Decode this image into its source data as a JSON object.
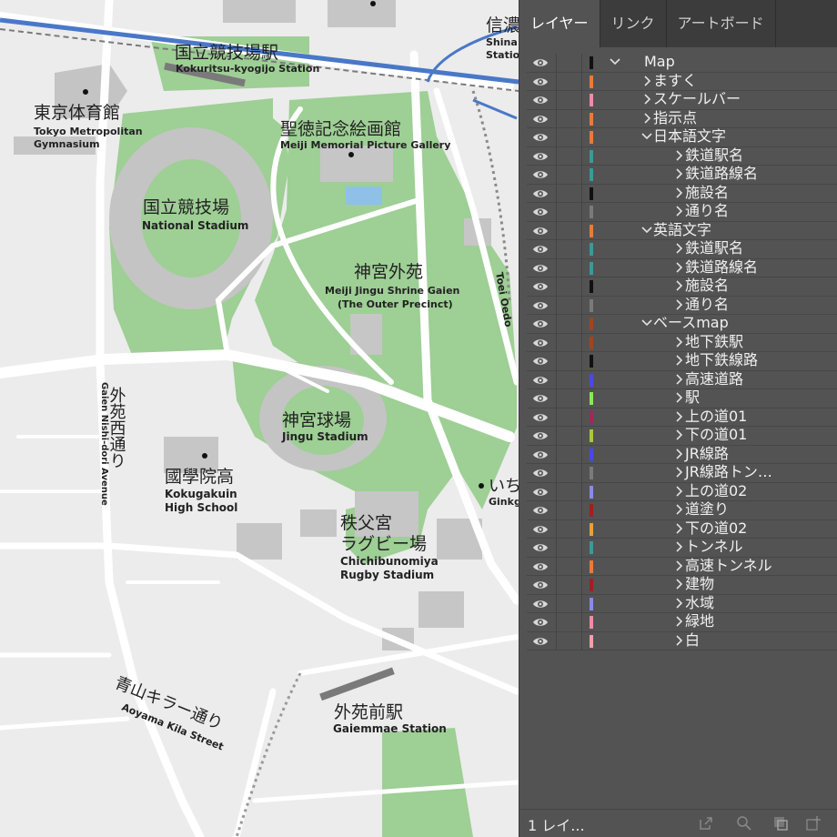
{
  "map": {
    "labels": {
      "kokuritsu_station_ja": "国立競技場駅",
      "kokuritsu_station_en": "Kokuritsu-kyogijo Station",
      "tokyo_gym_ja": "東京体育館",
      "tokyo_gym_en1": "Tokyo Metropolitan",
      "tokyo_gym_en2": "Gymnasium",
      "meiji_gallery_ja": "聖徳記念絵画館",
      "meiji_gallery_en": "Meiji Memorial Picture Gallery",
      "national_stadium_ja": "国立競技場",
      "national_stadium_en": "National Stadium",
      "gaien_ja": "神宮外苑",
      "gaien_en1": "Meiji Jingu Shrine Gaien",
      "gaien_en2": "(The Outer Precinct)",
      "jingu_stadium_ja": "神宮球場",
      "jingu_stadium_en": "Jingu Stadium",
      "gaien_nishi_ja": "外苑西通り",
      "gaien_nishi_en": "Gaien Nishi-dori Avenue",
      "kokugakuin_ja": "國學院高",
      "kokugakuin_en1": "Kokugakuin",
      "kokugakuin_en2": "High School",
      "chichibu_ja1": "秩父宮",
      "chichibu_ja2": "ラグビー場",
      "chichibu_en1": "Chichibunomiya",
      "chichibu_en2": "Rugby Stadium",
      "aoyama_ja": "青山キラー通り",
      "aoyama_en": "Aoyama Kila Street",
      "gaiemmae_ja": "外苑前駅",
      "gaiemmae_en": "Gaiemmae Station",
      "shinanomachi_ja": "信濃",
      "shinanomachi_en1": "Shina",
      "shinanomachi_en2": "Statio",
      "toei_oedo": "Toei Oedo",
      "icho_ja": "いち",
      "icho_en": "Ginkg"
    }
  },
  "panel": {
    "tabs": [
      "レイヤー",
      "リンク",
      "アートボード"
    ],
    "layers": [
      {
        "label": "Map",
        "color": "#111111",
        "depth": 0,
        "expanded": true
      },
      {
        "label": "ますく",
        "color": "#e87a3a",
        "depth": 1,
        "expanded": false
      },
      {
        "label": "スケールバー",
        "color": "#f08aa8",
        "depth": 1,
        "expanded": false
      },
      {
        "label": "指示点",
        "color": "#e87a3a",
        "depth": 1,
        "expanded": false
      },
      {
        "label": "日本語文字",
        "color": "#e87a3a",
        "depth": 1,
        "expanded": true
      },
      {
        "label": "鉄道駅名",
        "color": "#3a9a9a",
        "depth": 2,
        "expanded": false
      },
      {
        "label": "鉄道路線名",
        "color": "#3a9a9a",
        "depth": 2,
        "expanded": false
      },
      {
        "label": "施設名",
        "color": "#111111",
        "depth": 2,
        "expanded": false
      },
      {
        "label": "通り名",
        "color": "#7a7a7a",
        "depth": 2,
        "expanded": false
      },
      {
        "label": "英語文字",
        "color": "#e87a3a",
        "depth": 1,
        "expanded": true
      },
      {
        "label": "鉄道駅名",
        "color": "#3a9a9a",
        "depth": 2,
        "expanded": false
      },
      {
        "label": "鉄道路線名",
        "color": "#3a9a9a",
        "depth": 2,
        "expanded": false
      },
      {
        "label": "施設名",
        "color": "#111111",
        "depth": 2,
        "expanded": false
      },
      {
        "label": "通り名",
        "color": "#7a7a7a",
        "depth": 2,
        "expanded": false
      },
      {
        "label": "ベースmap",
        "color": "#a0461e",
        "depth": 1,
        "expanded": true
      },
      {
        "label": "地下鉄駅",
        "color": "#a0461e",
        "depth": 2,
        "expanded": false
      },
      {
        "label": "地下鉄線路",
        "color": "#111111",
        "depth": 2,
        "expanded": false
      },
      {
        "label": "高速道路",
        "color": "#4a4ae0",
        "depth": 2,
        "expanded": false
      },
      {
        "label": "駅",
        "color": "#8ae85a",
        "depth": 2,
        "expanded": false
      },
      {
        "label": "上の道01",
        "color": "#a0285a",
        "depth": 2,
        "expanded": false
      },
      {
        "label": "下の道01",
        "color": "#a8c83a",
        "depth": 2,
        "expanded": false
      },
      {
        "label": "JR線路",
        "color": "#4a4ae0",
        "depth": 2,
        "expanded": false
      },
      {
        "label": "JR線路トン…",
        "color": "#7a7a7a",
        "depth": 2,
        "expanded": false
      },
      {
        "label": "上の道02",
        "color": "#8a8ae8",
        "depth": 2,
        "expanded": false
      },
      {
        "label": "道塗り",
        "color": "#a02020",
        "depth": 2,
        "expanded": false
      },
      {
        "label": "下の道02",
        "color": "#e8a03a",
        "depth": 2,
        "expanded": false
      },
      {
        "label": "トンネル",
        "color": "#3a9a9a",
        "depth": 2,
        "expanded": false
      },
      {
        "label": "高速トンネル",
        "color": "#e87a3a",
        "depth": 2,
        "expanded": false
      },
      {
        "label": "建物",
        "color": "#a02020",
        "depth": 2,
        "expanded": false
      },
      {
        "label": "水域",
        "color": "#8a8ae8",
        "depth": 2,
        "expanded": false
      },
      {
        "label": "緑地",
        "color": "#f08aa8",
        "depth": 2,
        "expanded": false
      },
      {
        "label": "白",
        "color": "#f0a0a8",
        "depth": 2,
        "expanded": false
      }
    ],
    "footer_count": "1 レイ..."
  }
}
